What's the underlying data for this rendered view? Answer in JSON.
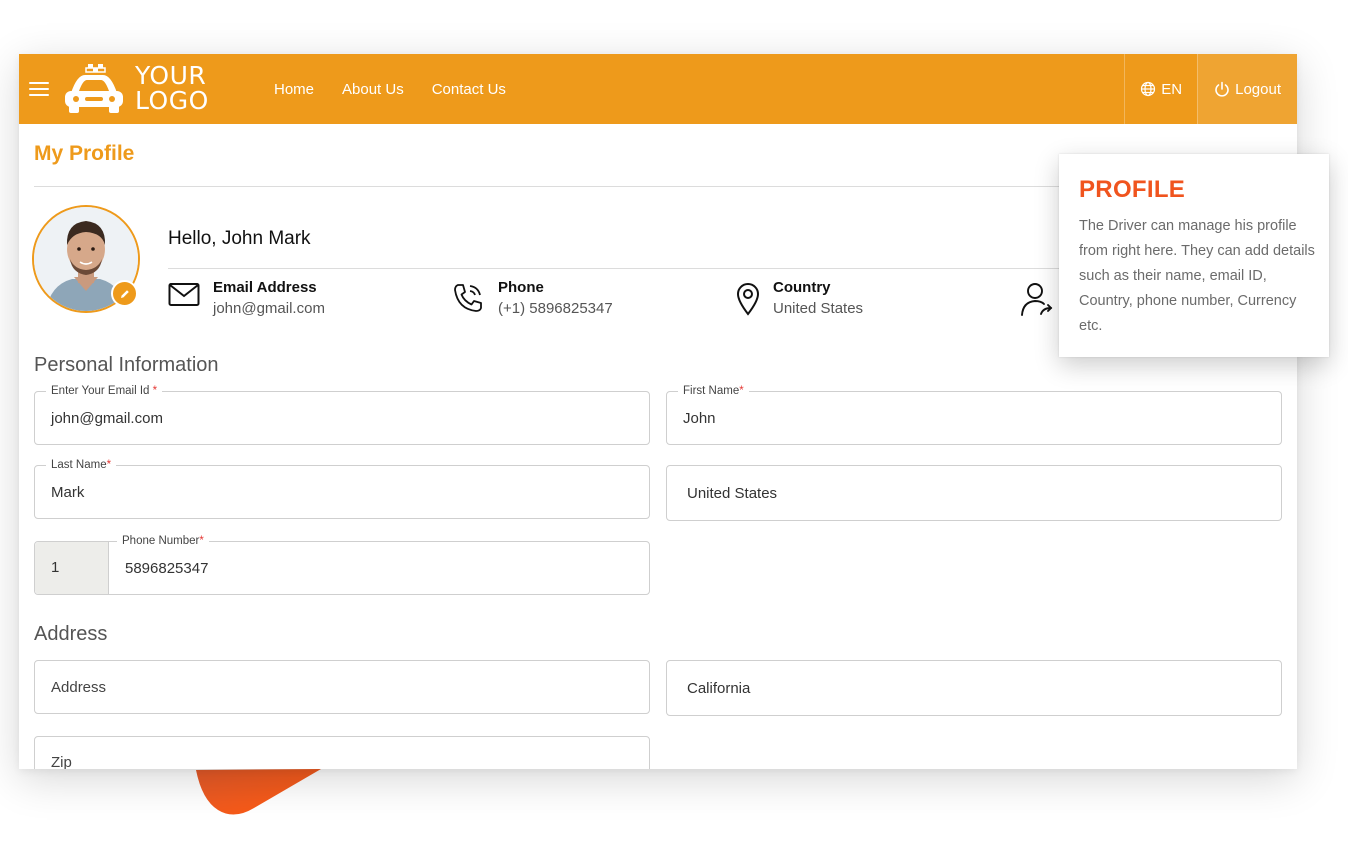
{
  "navbar": {
    "logo_line1": "YOUR",
    "logo_line2": "LOGO",
    "links": [
      "Home",
      "About Us",
      "Contact Us"
    ],
    "language": "EN",
    "logout": "Logout"
  },
  "page": {
    "title": "My Profile"
  },
  "profile": {
    "greeting": "Hello, John Mark",
    "email_label": "Email Address",
    "email_value": "john@gmail.com",
    "phone_label": "Phone",
    "phone_value": "(+1) 5896825347",
    "country_label": "Country",
    "country_value": "United States"
  },
  "personal": {
    "heading": "Personal Information",
    "email_label": "Enter Your Email Id",
    "email_value": "john@gmail.com",
    "first_name_label": "First Name",
    "first_name_value": "John",
    "last_name_label": "Last Name",
    "last_name_value": "Mark",
    "country_value": "United States",
    "phone_label": "Phone Number",
    "phone_code": "1",
    "phone_value": "5896825347"
  },
  "address": {
    "heading": "Address",
    "address_placeholder": "Address",
    "state_value": "California",
    "zip_placeholder": "Zip"
  },
  "callout": {
    "title": "PROFILE",
    "body": "The Driver can manage his profile from right here. They can add details such as their name, email ID, Country, phone number, Currency etc."
  },
  "colors": {
    "brand": "#ee9a1b",
    "callout_title": "#f0541e",
    "required": "#e53935"
  }
}
